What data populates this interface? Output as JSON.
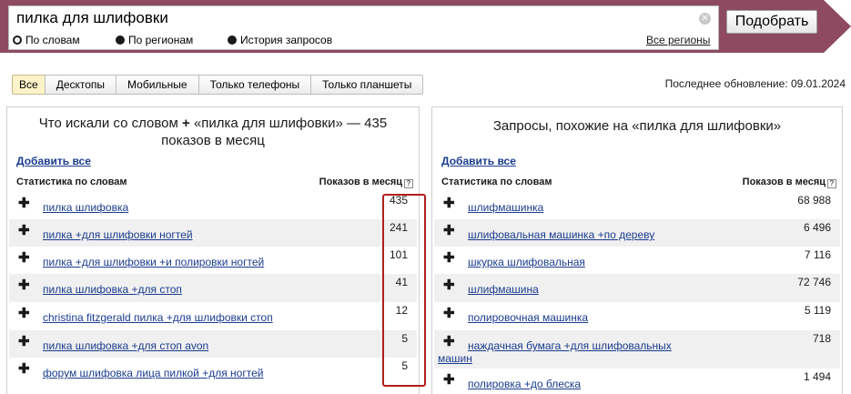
{
  "search": {
    "query": "пилка для шлифовки",
    "submit_label": "Подобрать",
    "options": [
      "По словам",
      "По регионам",
      "История запросов"
    ],
    "selected_option": "По словам",
    "regions_link": "Все регионы"
  },
  "tabs": {
    "items": [
      "Все",
      "Десктопы",
      "Мобильные",
      "Только телефоны",
      "Только планшеты"
    ],
    "active": "Все"
  },
  "last_update": "Последнее обновление: 09.01.2024",
  "left_panel": {
    "title_part1": "Что искали со словом",
    "title_plus": "+",
    "title_part2": "«пилка для шлифовки» — 435 показов в месяц",
    "add_all": "Добавить все",
    "col_words": "Статистика по словам",
    "col_shows": "Показов в месяц",
    "rows": [
      {
        "phrase": "пилка шлифовка",
        "count": "435"
      },
      {
        "phrase": "пилка +для шлифовки ногтей",
        "count": "241"
      },
      {
        "phrase": "пилка +для шлифовки +и полировки ногтей",
        "count": "101"
      },
      {
        "phrase": "пилка шлифовка +для стоп",
        "count": "41"
      },
      {
        "phrase": "christina fitzgerald пилка +для шлифовки стоп",
        "count": "12"
      },
      {
        "phrase": "пилка шлифовка +для стоп avon",
        "count": "5"
      },
      {
        "phrase": "форум шлифовка лица пилкой +для ногтей",
        "count": "5"
      }
    ]
  },
  "right_panel": {
    "title": "Запросы, похожие на «пилка для шлифовки»",
    "add_all": "Добавить все",
    "col_words": "Статистика по словам",
    "col_shows": "Показов в месяц",
    "rows": [
      {
        "phrase": "шлифмашинка",
        "count": "68 988"
      },
      {
        "phrase": "шлифовальная машинка +по дереву",
        "count": "6 496"
      },
      {
        "phrase": "шкурка шлифовальная",
        "count": "7 116"
      },
      {
        "phrase": "шлифмашина",
        "count": "72 746"
      },
      {
        "phrase": "полировочная машинка",
        "count": "5 119"
      },
      {
        "phrase": "наждачная бумага +для шлифовальных",
        "phrase_line2": "машин",
        "count": "718"
      },
      {
        "phrase": "полировка +до блеска",
        "count": "1 494"
      }
    ]
  },
  "icons": {
    "clear": "clear-icon",
    "help": "help-icon",
    "plus": "plus-icon",
    "radio": "radio-icon"
  },
  "colors": {
    "header_bg": "#8e4a60",
    "link": "#1a3c8e",
    "highlight": "#b01e1e",
    "active_tab": "#fef3c8",
    "row_shade": "#f0f0f0"
  }
}
